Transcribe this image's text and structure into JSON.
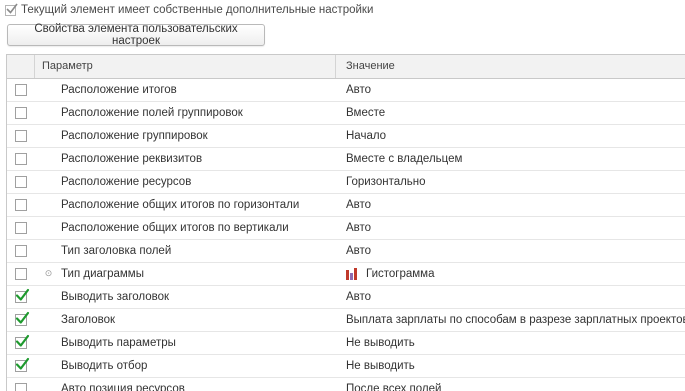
{
  "top_option": {
    "label": "Текущий элемент имеет собственные дополнительные настройки",
    "checked": true
  },
  "properties_button": {
    "label": "Свойства элемента пользовательских настроек"
  },
  "table": {
    "headers": {
      "param": "Параметр",
      "value": "Значение"
    },
    "rows": [
      {
        "checked": false,
        "param": "Расположение итогов",
        "value": "Авто"
      },
      {
        "checked": false,
        "param": "Расположение полей группировок",
        "value": "Вместе"
      },
      {
        "checked": false,
        "param": "Расположение группировок",
        "value": "Начало"
      },
      {
        "checked": false,
        "param": "Расположение реквизитов",
        "value": "Вместе с владельцем"
      },
      {
        "checked": false,
        "param": "Расположение ресурсов",
        "value": "Горизонтально"
      },
      {
        "checked": false,
        "param": "Расположение общих итогов по горизонтали",
        "value": "Авто"
      },
      {
        "checked": false,
        "param": "Расположение общих итогов по вертикали",
        "value": "Авто"
      },
      {
        "checked": false,
        "param": "Тип заголовка полей",
        "value": "Авто"
      },
      {
        "checked": false,
        "param": "Тип диаграммы",
        "value": "Гистограмма",
        "expandable": true,
        "icon": "bar-chart-icon"
      },
      {
        "checked": true,
        "param": "Выводить заголовок",
        "value": "Авто"
      },
      {
        "checked": true,
        "param": "Заголовок",
        "value": "Выплата зарплаты по способам в разрезе зарплатных проектов"
      },
      {
        "checked": true,
        "param": "Выводить параметры",
        "value": "Не выводить"
      },
      {
        "checked": true,
        "param": "Выводить отбор",
        "value": "Не выводить"
      },
      {
        "checked": false,
        "param": "Авто позиция ресурсов",
        "value": "После всех полей"
      }
    ]
  },
  "colors": {
    "check_green": "#1e9a2e",
    "border": "#c9c9c9",
    "header_bg": "#f2f2f2"
  }
}
